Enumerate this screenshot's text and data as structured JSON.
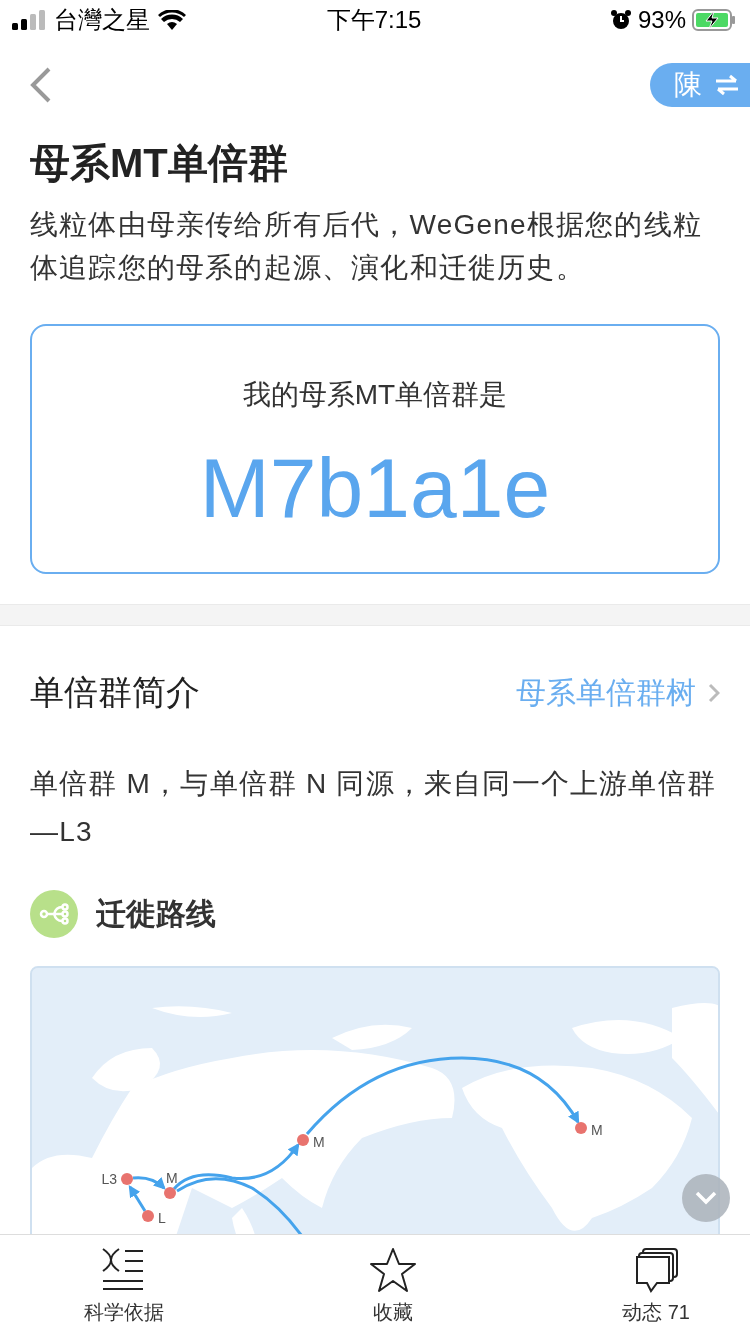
{
  "status_bar": {
    "carrier": "台灣之星",
    "time": "下午7:15",
    "battery": "93%"
  },
  "nav": {
    "profile": "陳"
  },
  "title": "母系MT单倍群",
  "description": "线粒体由母亲传给所有后代，WeGene根据您的线粒体追踪您的母系的起源、演化和迁徙历史。",
  "result": {
    "label": "我的母系MT单倍群是",
    "haplogroup": "M7b1a1e"
  },
  "intro": {
    "title": "单倍群简介",
    "link": "母系单倍群树",
    "text": "单倍群 M，与单倍群 N 同源，来自同一个上游单倍群—L3"
  },
  "route": {
    "title": "迁徙路线"
  },
  "map": {
    "points": [
      {
        "label": "L3"
      },
      {
        "label": "M"
      },
      {
        "label": "L"
      },
      {
        "label": "M"
      },
      {
        "label": "M"
      }
    ]
  },
  "tab_bar": [
    {
      "kind": "science",
      "label": "科学依据"
    },
    {
      "kind": "star",
      "label": "收藏"
    },
    {
      "kind": "comments",
      "label": "动态",
      "count": "71"
    }
  ]
}
